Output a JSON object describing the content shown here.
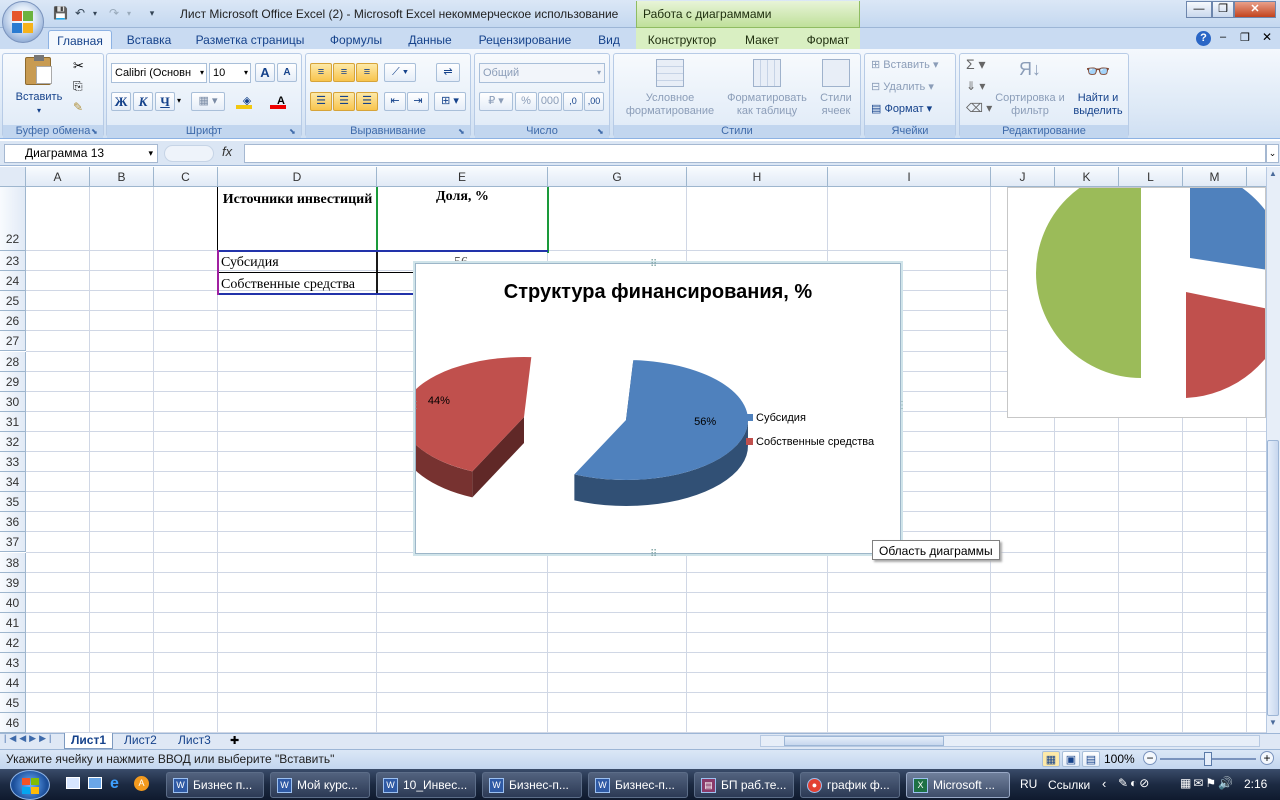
{
  "window": {
    "title": "Лист Microsoft Office Excel (2)  -  Microsoft Excel некоммерческое использование",
    "context_title": "Работа с диаграммами"
  },
  "tabs": [
    "Главная",
    "Вставка",
    "Разметка страницы",
    "Формулы",
    "Данные",
    "Рецензирование",
    "Вид",
    "Конструктор",
    "Макет",
    "Формат"
  ],
  "ribbon": {
    "clipboard": {
      "label": "Буфер обмена",
      "paste": "Вставить"
    },
    "font": {
      "label": "Шрифт",
      "name": "Calibri (Основн",
      "size": "10",
      "bold": "Ж",
      "italic": "К",
      "underline": "Ч",
      "grow": "A",
      "shrink": "A"
    },
    "alignment": {
      "label": "Выравнивание"
    },
    "number": {
      "label": "Число",
      "format": "Общий",
      "percent": "%",
      "thousands": "000"
    },
    "styles": {
      "label": "Стили",
      "conditional": "Условное форматирование",
      "as_table": "Форматировать как таблицу",
      "cell_styles": "Стили ячеек"
    },
    "cells": {
      "label": "Ячейки",
      "insert": "Вставить",
      "delete": "Удалить",
      "format": "Формат"
    },
    "editing": {
      "label": "Редактирование",
      "sort": "Сортировка и фильтр",
      "find": "Найти и выделить"
    }
  },
  "formula_bar": {
    "name_box": "Диаграмма 13",
    "fx": "fx",
    "value": ""
  },
  "columns": [
    "A",
    "B",
    "C",
    "D",
    "E",
    "F",
    "G",
    "H",
    "I",
    "J",
    "K",
    "L",
    "M"
  ],
  "rows": [
    "22",
    "23",
    "24",
    "25",
    "26",
    "27",
    "28",
    "29",
    "30",
    "31",
    "32",
    "33",
    "34",
    "35",
    "36",
    "37",
    "38",
    "39",
    "40",
    "41",
    "42",
    "43",
    "44",
    "45",
    "46"
  ],
  "table": {
    "header_d": "Источники инвестиций",
    "header_e": "Доля, %",
    "r23_d": "Субсидия",
    "r23_e": "56",
    "r24_d": "Собственные средства"
  },
  "chart_data": {
    "type": "pie",
    "title": "Структура финансирования, %",
    "categories": [
      "Субсидия",
      "Собственные средства"
    ],
    "values": [
      56,
      44
    ],
    "labels": [
      "56%",
      "44%"
    ],
    "colors": [
      "#4f81bd",
      "#c0504d"
    ],
    "legend": "right",
    "exploded": true,
    "style": "3d"
  },
  "tooltip": "Область диаграммы",
  "sheets": [
    "Лист1",
    "Лист2",
    "Лист3"
  ],
  "status": {
    "text": "Укажите ячейку и нажмите ВВОД или выберите \"Вставить\"",
    "zoom": "100%"
  },
  "taskbar": {
    "items": [
      "Бизнес п...",
      "Мой курс...",
      "10_Инвес...",
      "Бизнес-п...",
      "Бизнес-п...",
      "БП раб.те...",
      "график ф...",
      "Microsoft ..."
    ],
    "lang": "RU",
    "links": "Ссылки",
    "time": "2:16"
  }
}
